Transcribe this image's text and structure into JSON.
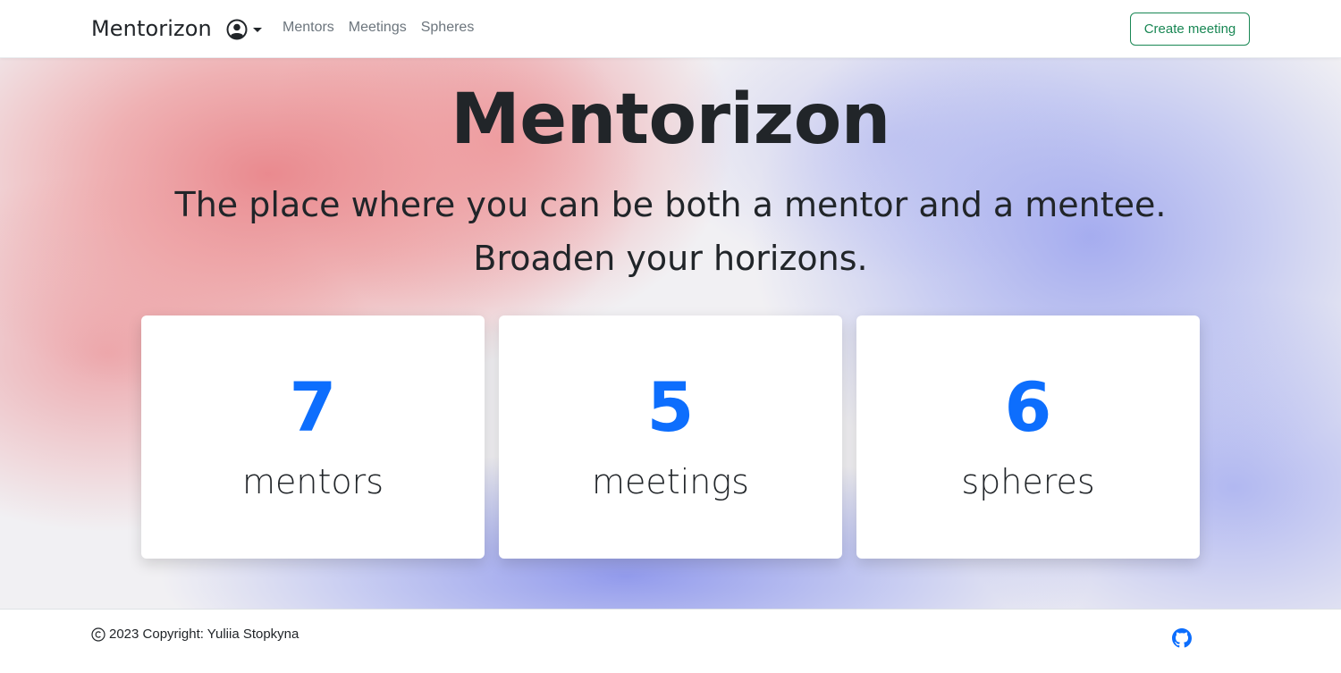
{
  "navbar": {
    "brand": "Mentorizon",
    "user_icon": "user-circle-icon",
    "links": [
      "Mentors",
      "Meetings",
      "Spheres"
    ],
    "create_button": "Create meeting"
  },
  "hero": {
    "title": "Mentorizon",
    "subtitle_line1": "The place where you can be both a mentor and a mentee.",
    "subtitle_line2": "Broaden your horizons."
  },
  "stats": [
    {
      "value": "7",
      "label": "mentors"
    },
    {
      "value": "5",
      "label": "meetings"
    },
    {
      "value": "6",
      "label": "spheres"
    }
  ],
  "footer": {
    "copyright": "2023 Copyright: Yuliia Stopkyna",
    "copyright_icon": "copyright-icon",
    "github_icon": "github-icon"
  },
  "colors": {
    "accent": "#0d6efd",
    "success": "#198754",
    "text": "#212529",
    "muted": "#6c757d"
  }
}
